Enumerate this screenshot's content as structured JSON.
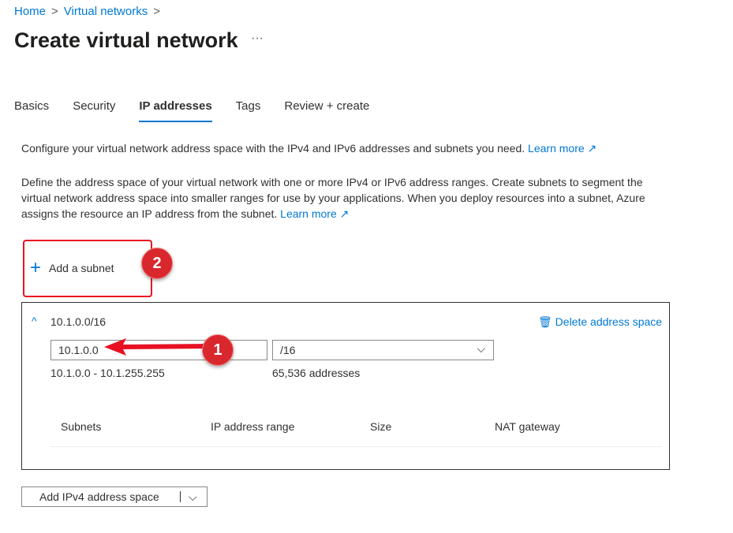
{
  "breadcrumb": [
    "Home",
    "Virtual networks"
  ],
  "title": "Create virtual network",
  "more": "···",
  "tabs": [
    "Basics",
    "Security",
    "IP addresses",
    "Tags",
    "Review + create"
  ],
  "intro": "Configure your virtual network address space with the IPv4 and IPv6 addresses and subnets you need.",
  "learn_more": "Learn more",
  "description": "Define the address space of your virtual network with one or more IPv4 or IPv6 address ranges. Create subnets to segment the virtual network address space into smaller ranges for use by your applications. When you deploy resources into a subnet, Azure assigns the resource an IP address from the subnet.",
  "add_subnet": "Add a subnet",
  "annotations": [
    "1",
    "2"
  ],
  "address_space": {
    "header": "10.1.0.0/16",
    "delete": "Delete address space",
    "ip": "10.1.0.0",
    "prefix": "/16",
    "range": "10.1.0.0 - 10.1.255.255",
    "count": "65,536 addresses"
  },
  "columns": [
    "Subnets",
    "IP address range",
    "Size",
    "NAT gateway"
  ],
  "add_space": "Add IPv4 address space"
}
